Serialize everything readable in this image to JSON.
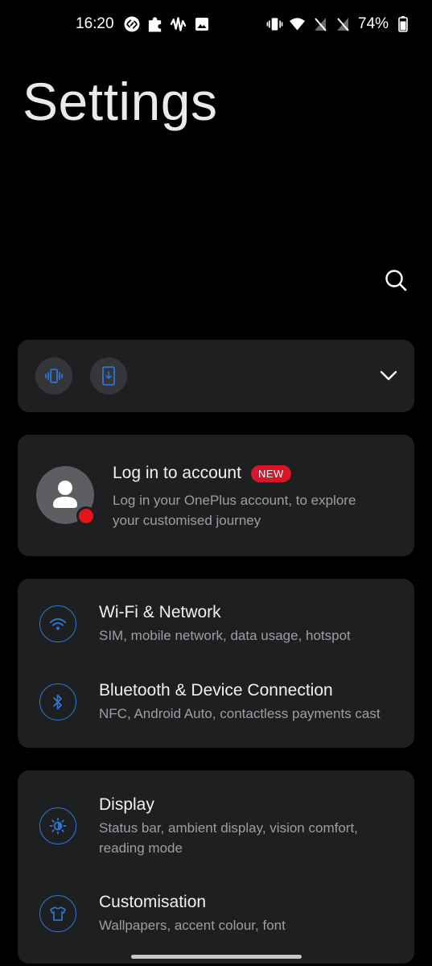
{
  "status_bar": {
    "time": "16:20",
    "left_icons": [
      "shazam-icon",
      "puzzle-icon",
      "waveform-icon",
      "image-icon"
    ],
    "right_icons": [
      "vibrate-icon",
      "wifi-icon",
      "no-sim-icon",
      "no-sim-icon"
    ],
    "battery_percent": "74%"
  },
  "header": {
    "title": "Settings"
  },
  "quick_settings": {
    "toggles": [
      "vibrate-icon",
      "phone-download-icon"
    ]
  },
  "account": {
    "title": "Log in to account",
    "badge": "NEW",
    "subtitle": "Log in your OnePlus account, to explore your customised journey"
  },
  "groups": [
    {
      "items": [
        {
          "title": "Wi-Fi & Network",
          "subtitle": "SIM, mobile network, data usage, hotspot",
          "icon": "wifi-icon"
        },
        {
          "title": "Bluetooth & Device Connection",
          "subtitle": "NFC, Android Auto, contactless payments cast",
          "icon": "bluetooth-icon"
        }
      ]
    },
    {
      "items": [
        {
          "title": "Display",
          "subtitle": "Status bar, ambient display, vision comfort, reading mode",
          "icon": "brightness-icon"
        },
        {
          "title": "Customisation",
          "subtitle": "Wallpapers, accent colour, font",
          "icon": "tshirt-icon"
        }
      ]
    }
  ],
  "colors": {
    "accent": "#2f74d0",
    "badge": "#d6162b",
    "card": "#1e1f21",
    "background": "#000000"
  }
}
